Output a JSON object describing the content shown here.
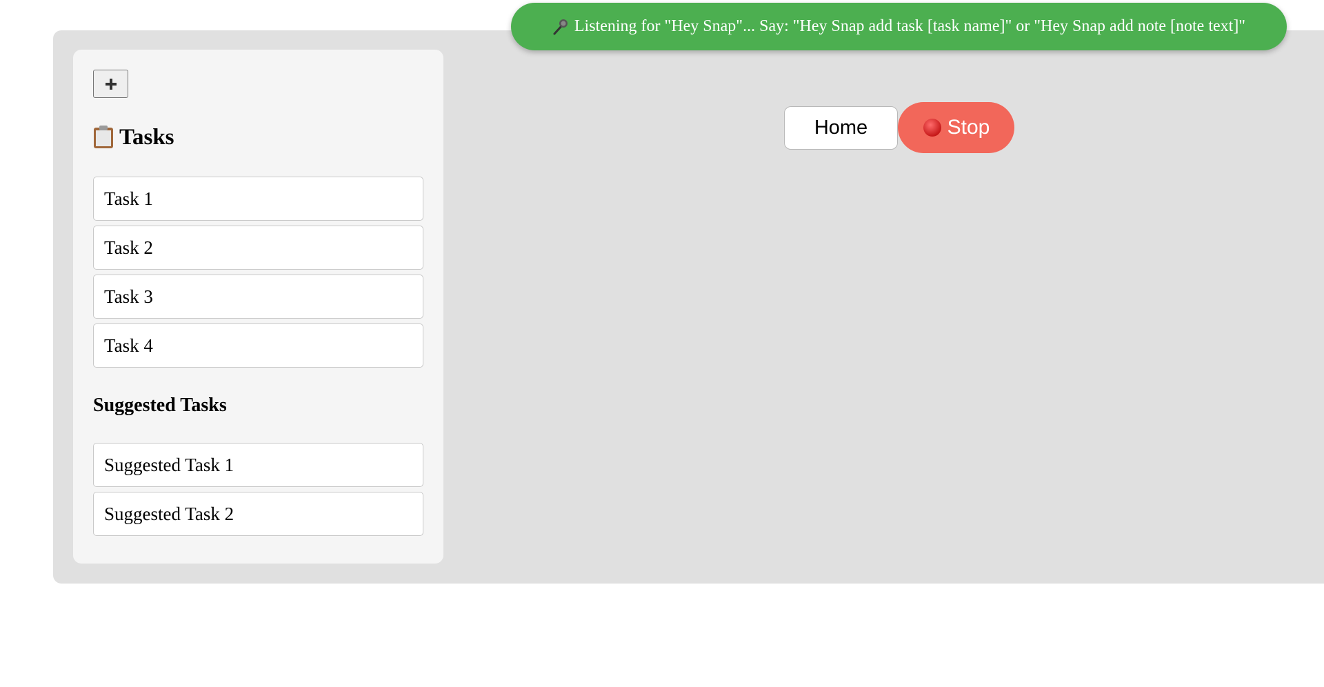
{
  "toast": {
    "icon": "microphone-icon",
    "text": "Listening for \"Hey Snap\"... Say: \"Hey Snap add task [task name]\" or \"Hey Snap add note [note text]\"",
    "color": "#4caf50"
  },
  "sidebar": {
    "add_button_icon": "plus-icon",
    "tasks_title": "Tasks",
    "tasks_icon": "clipboard-icon",
    "tasks": [
      {
        "label": "Task 1"
      },
      {
        "label": "Task 2"
      },
      {
        "label": "Task 3"
      },
      {
        "label": "Task 4"
      }
    ],
    "suggested_title": "Suggested Tasks",
    "suggested": [
      {
        "label": "Suggested Task 1"
      },
      {
        "label": "Suggested Task 2"
      }
    ]
  },
  "controls": {
    "home_label": "Home",
    "stop_label": "Stop",
    "stop_icon": "red-circle-icon",
    "stop_color": "#f2675a"
  }
}
